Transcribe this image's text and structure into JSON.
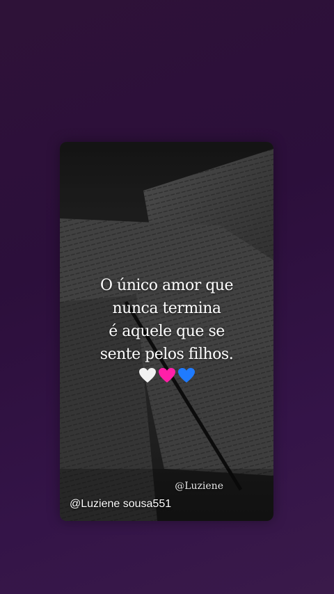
{
  "quote": {
    "line1": "O único amor que",
    "line2": "nunca termina",
    "line3": "é aquele que se",
    "line4": "sente pelos filhos."
  },
  "hearts": [
    {
      "name": "white-heart-icon",
      "color": "#f2f2f2"
    },
    {
      "name": "pink-heart-icon",
      "color": "#ff1fa8"
    },
    {
      "name": "blue-heart-icon",
      "color": "#1f7bff"
    }
  ],
  "card_watermark": "@Luziene",
  "user_watermark": "@Luziene sousa551",
  "colors": {
    "background": "#2c0f3b",
    "text": "#ffffff"
  }
}
